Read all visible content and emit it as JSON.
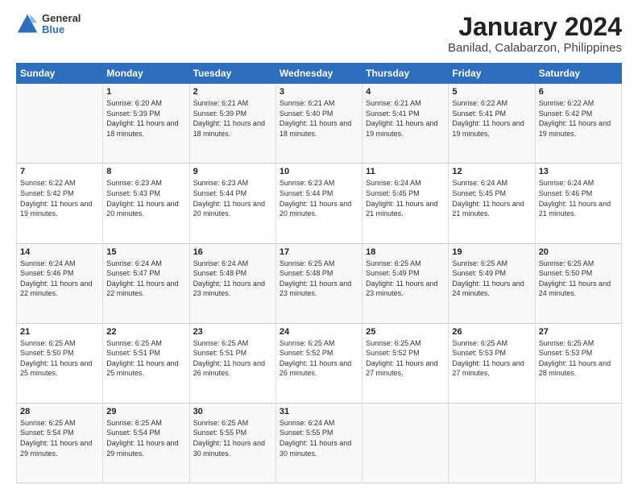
{
  "logo": {
    "line1": "General",
    "line2": "Blue"
  },
  "title": "January 2024",
  "subtitle": "Banilad, Calabarzon, Philippines",
  "headers": [
    "Sunday",
    "Monday",
    "Tuesday",
    "Wednesday",
    "Thursday",
    "Friday",
    "Saturday"
  ],
  "weeks": [
    [
      {
        "day": "",
        "text": ""
      },
      {
        "day": "1",
        "text": "Sunrise: 6:20 AM\nSunset: 5:39 PM\nDaylight: 11 hours and 18 minutes."
      },
      {
        "day": "2",
        "text": "Sunrise: 6:21 AM\nSunset: 5:39 PM\nDaylight: 11 hours and 18 minutes."
      },
      {
        "day": "3",
        "text": "Sunrise: 6:21 AM\nSunset: 5:40 PM\nDaylight: 11 hours and 18 minutes."
      },
      {
        "day": "4",
        "text": "Sunrise: 6:21 AM\nSunset: 5:41 PM\nDaylight: 11 hours and 19 minutes."
      },
      {
        "day": "5",
        "text": "Sunrise: 6:22 AM\nSunset: 5:41 PM\nDaylight: 11 hours and 19 minutes."
      },
      {
        "day": "6",
        "text": "Sunrise: 6:22 AM\nSunset: 5:42 PM\nDaylight: 11 hours and 19 minutes."
      }
    ],
    [
      {
        "day": "7",
        "text": "Sunrise: 6:22 AM\nSunset: 5:42 PM\nDaylight: 11 hours and 19 minutes."
      },
      {
        "day": "8",
        "text": "Sunrise: 6:23 AM\nSunset: 5:43 PM\nDaylight: 11 hours and 20 minutes."
      },
      {
        "day": "9",
        "text": "Sunrise: 6:23 AM\nSunset: 5:44 PM\nDaylight: 11 hours and 20 minutes."
      },
      {
        "day": "10",
        "text": "Sunrise: 6:23 AM\nSunset: 5:44 PM\nDaylight: 11 hours and 20 minutes."
      },
      {
        "day": "11",
        "text": "Sunrise: 6:24 AM\nSunset: 5:45 PM\nDaylight: 11 hours and 21 minutes."
      },
      {
        "day": "12",
        "text": "Sunrise: 6:24 AM\nSunset: 5:45 PM\nDaylight: 11 hours and 21 minutes."
      },
      {
        "day": "13",
        "text": "Sunrise: 6:24 AM\nSunset: 5:46 PM\nDaylight: 11 hours and 21 minutes."
      }
    ],
    [
      {
        "day": "14",
        "text": "Sunrise: 6:24 AM\nSunset: 5:46 PM\nDaylight: 11 hours and 22 minutes."
      },
      {
        "day": "15",
        "text": "Sunrise: 6:24 AM\nSunset: 5:47 PM\nDaylight: 11 hours and 22 minutes."
      },
      {
        "day": "16",
        "text": "Sunrise: 6:24 AM\nSunset: 5:48 PM\nDaylight: 11 hours and 23 minutes."
      },
      {
        "day": "17",
        "text": "Sunrise: 6:25 AM\nSunset: 5:48 PM\nDaylight: 11 hours and 23 minutes."
      },
      {
        "day": "18",
        "text": "Sunrise: 6:25 AM\nSunset: 5:49 PM\nDaylight: 11 hours and 23 minutes."
      },
      {
        "day": "19",
        "text": "Sunrise: 6:25 AM\nSunset: 5:49 PM\nDaylight: 11 hours and 24 minutes."
      },
      {
        "day": "20",
        "text": "Sunrise: 6:25 AM\nSunset: 5:50 PM\nDaylight: 11 hours and 24 minutes."
      }
    ],
    [
      {
        "day": "21",
        "text": "Sunrise: 6:25 AM\nSunset: 5:50 PM\nDaylight: 11 hours and 25 minutes."
      },
      {
        "day": "22",
        "text": "Sunrise: 6:25 AM\nSunset: 5:51 PM\nDaylight: 11 hours and 25 minutes."
      },
      {
        "day": "23",
        "text": "Sunrise: 6:25 AM\nSunset: 5:51 PM\nDaylight: 11 hours and 26 minutes."
      },
      {
        "day": "24",
        "text": "Sunrise: 6:25 AM\nSunset: 5:52 PM\nDaylight: 11 hours and 26 minutes."
      },
      {
        "day": "25",
        "text": "Sunrise: 6:25 AM\nSunset: 5:52 PM\nDaylight: 11 hours and 27 minutes."
      },
      {
        "day": "26",
        "text": "Sunrise: 6:25 AM\nSunset: 5:53 PM\nDaylight: 11 hours and 27 minutes."
      },
      {
        "day": "27",
        "text": "Sunrise: 6:25 AM\nSunset: 5:53 PM\nDaylight: 11 hours and 28 minutes."
      }
    ],
    [
      {
        "day": "28",
        "text": "Sunrise: 6:25 AM\nSunset: 5:54 PM\nDaylight: 11 hours and 29 minutes."
      },
      {
        "day": "29",
        "text": "Sunrise: 6:25 AM\nSunset: 5:54 PM\nDaylight: 11 hours and 29 minutes."
      },
      {
        "day": "30",
        "text": "Sunrise: 6:25 AM\nSunset: 5:55 PM\nDaylight: 11 hours and 30 minutes."
      },
      {
        "day": "31",
        "text": "Sunrise: 6:24 AM\nSunset: 5:55 PM\nDaylight: 11 hours and 30 minutes."
      },
      {
        "day": "",
        "text": ""
      },
      {
        "day": "",
        "text": ""
      },
      {
        "day": "",
        "text": ""
      }
    ]
  ]
}
